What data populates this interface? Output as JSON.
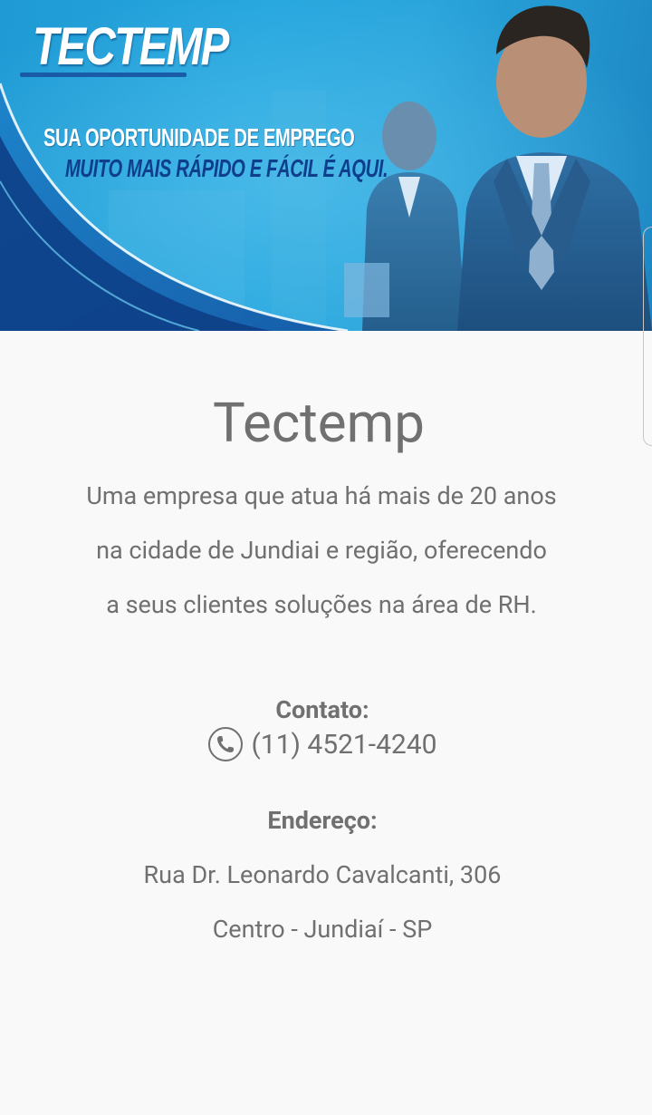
{
  "banner": {
    "logo_text": "TECTEMP",
    "tagline_line1": "SUA OPORTUNIDADE DE EMPREGO",
    "tagline_line2": "MUITO MAIS RÁPIDO E FÁCIL É AQUI.",
    "colors": {
      "background": "#25a6de",
      "logo_underline": "#1a5ba8",
      "tagline_line2": "#0f3f8c"
    }
  },
  "company": {
    "name": "Tectemp",
    "description_lines": [
      "Uma empresa que atua há mais de 20 anos",
      "na cidade de Jundiai e região, oferecendo",
      "a seus clientes soluções na área de RH."
    ]
  },
  "contact": {
    "label": "Contato:",
    "icon": "phone-icon",
    "phone": "(11) 4521-4240"
  },
  "address": {
    "label": "Endereço:",
    "line1": "Rua Dr. Leonardo Cavalcanti, 306",
    "line2": "Centro - Jundiaí - SP"
  }
}
